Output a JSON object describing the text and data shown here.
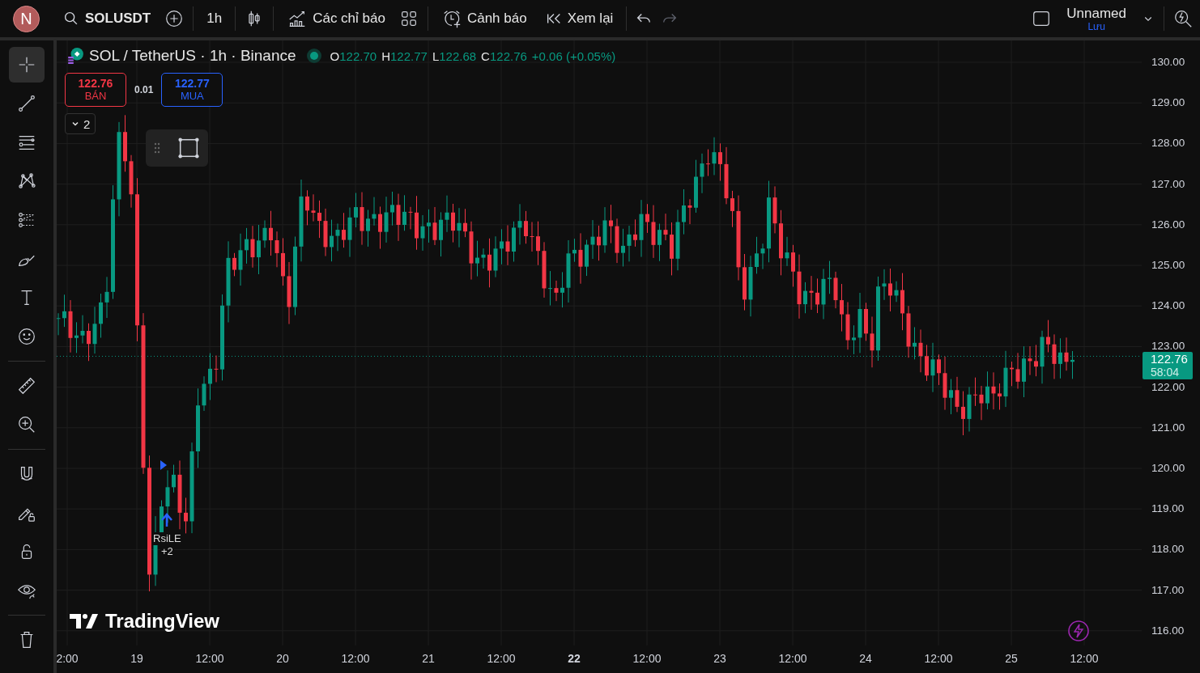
{
  "toolbar": {
    "avatar": "N",
    "symbol": "SOLUSDT",
    "interval": "1h",
    "indicators": "Các chỉ báo",
    "alerts": "Cảnh báo",
    "replay": "Xem lại",
    "redo": {
      "disabled": true
    },
    "layout_name": "Unnamed",
    "save": "Lưu"
  },
  "tool_groups": [
    {
      "tools": [
        {
          "kind": "crosshair",
          "selected": true
        },
        {
          "kind": "trend-line",
          "selected": false
        },
        {
          "kind": "horizontal-lines",
          "selected": false
        },
        {
          "kind": "pattern",
          "selected": false
        },
        {
          "kind": "fib",
          "selected": false
        },
        {
          "kind": "brush",
          "selected": false
        },
        {
          "kind": "text",
          "selected": false
        },
        {
          "kind": "emoji",
          "selected": false
        }
      ]
    },
    {
      "tools": [
        {
          "kind": "ruler",
          "selected": false
        },
        {
          "kind": "zoom",
          "selected": false
        }
      ]
    },
    {
      "tools": [
        {
          "kind": "magnet",
          "selected": false
        },
        {
          "kind": "lock-drawing",
          "selected": false
        },
        {
          "kind": "lock",
          "selected": false
        },
        {
          "kind": "eye",
          "selected": false
        }
      ]
    },
    {
      "tools": [
        {
          "kind": "trash",
          "selected": false
        }
      ]
    }
  ],
  "legend": {
    "title": "SOL / TetherUS · 1h · Binance",
    "ohlc": [
      {
        "label": "O",
        "value": "122.70"
      },
      {
        "label": "H",
        "value": "122.77"
      },
      {
        "label": "L",
        "value": "122.68"
      },
      {
        "label": "C",
        "value": "122.76"
      }
    ],
    "change": "+0.06 (+0.05%)",
    "change_positive": true
  },
  "trade": {
    "sell_price": "122.76",
    "sell_label": "BÁN",
    "spread": "0.01",
    "buy_price": "122.77",
    "buy_label": "MUA"
  },
  "indicators_toggle": "2",
  "signal": {
    "name": "RsiLE",
    "count": "+2"
  },
  "price_axis": [
    "130.00",
    "129.00",
    "128.00",
    "127.00",
    "126.00",
    "125.00",
    "124.00",
    "123.00",
    "122.00",
    "121.00",
    "120.00",
    "119.00",
    "118.00",
    "117.00",
    "116.00"
  ],
  "last_price": {
    "price": "122.76",
    "countdown": "58:04"
  },
  "time_axis": [
    {
      "label": "2:00",
      "bold": false
    },
    {
      "label": "19",
      "bold": false
    },
    {
      "label": "12:00",
      "bold": false
    },
    {
      "label": "20",
      "bold": false
    },
    {
      "label": "12:00",
      "bold": false
    },
    {
      "label": "21",
      "bold": false
    },
    {
      "label": "12:00",
      "bold": false
    },
    {
      "label": "22",
      "bold": true
    },
    {
      "label": "12:00",
      "bold": false
    },
    {
      "label": "23",
      "bold": false
    },
    {
      "label": "12:00",
      "bold": false
    },
    {
      "label": "24",
      "bold": false
    },
    {
      "label": "12:00",
      "bold": false
    },
    {
      "label": "25",
      "bold": false
    },
    {
      "label": "12:00",
      "bold": false
    }
  ],
  "brand": "TradingView"
}
